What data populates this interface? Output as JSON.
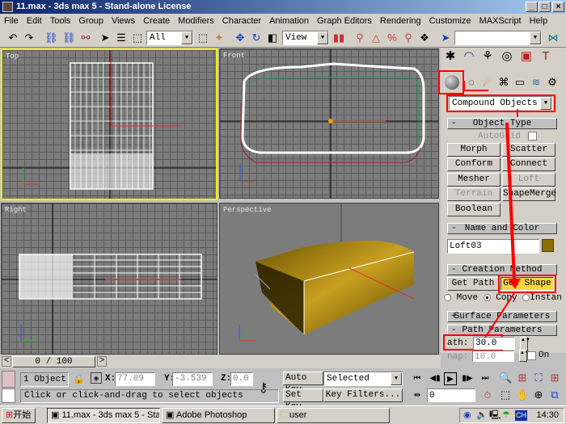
{
  "window": {
    "title": "11.max - 3ds max 5 - Stand-alone License",
    "minimize": "_",
    "maximize": "□",
    "close": "×"
  },
  "menu": [
    "File",
    "Edit",
    "Tools",
    "Group",
    "Views",
    "Create",
    "Modifiers",
    "Character",
    "Animation",
    "Graph Editors",
    "Rendering",
    "Customize",
    "MAXScript",
    "Help"
  ],
  "toolbar": {
    "selection_filter": "All",
    "reference_coord": "View",
    "named_selection": ""
  },
  "viewports": {
    "top": "Top",
    "front": "Front",
    "right": "Right",
    "perspective": "Perspective"
  },
  "command_panel": {
    "category_dropdown": "Compound Objects",
    "object_type": {
      "header": "Object Type",
      "autogrid_label": "AutoGrid",
      "buttons": [
        {
          "label": "Morph",
          "enabled": true
        },
        {
          "label": "Scatter",
          "enabled": true
        },
        {
          "label": "Conform",
          "enabled": true
        },
        {
          "label": "Connect",
          "enabled": true
        },
        {
          "label": "Mesher",
          "enabled": true
        },
        {
          "label": "Loft",
          "enabled": false
        },
        {
          "label": "Terrain",
          "enabled": false
        },
        {
          "label": "ShapeMerge",
          "enabled": true
        },
        {
          "label": "Boolean",
          "enabled": true
        }
      ]
    },
    "name_color": {
      "header": "Name and Color",
      "name": "Loft03",
      "color": "#8c6e00"
    },
    "creation_method": {
      "header": "Creation Method",
      "get_path": "Get Path",
      "get_shape": "Get Shape",
      "radio": [
        "Move",
        "Copy",
        "Instan"
      ],
      "selected": "Copy"
    },
    "surface_params_header": "Surface Parameters",
    "path_params": {
      "header": "Path Parameters",
      "path_label": "ath:",
      "path_value": "30.0",
      "snap_label": "nap:",
      "snap_value": "10.0",
      "on_label": "On"
    }
  },
  "timeline": {
    "frame_display": "0 / 100",
    "prev": "<",
    "next": ">"
  },
  "status": {
    "selection_count": "1 Object",
    "x_label": "X:",
    "x": "77.09",
    "y_label": "Y:",
    "y": "-3.539",
    "z_label": "Z:",
    "z": "0.0",
    "prompt": "Click or click-and-drag to select objects",
    "auto_key": "Auto Key",
    "set_key": "Set Key",
    "key_mode": "Selected",
    "key_filters": "Key Filters...",
    "current_frame": "0"
  },
  "taskbar": {
    "start": "开始",
    "tasks": [
      "11.max - 3ds max 5 - Sta...",
      "Adobe Photoshop",
      "user"
    ],
    "ime": "CH",
    "clock": "14:30"
  },
  "accent": {
    "highlight_red": "#ff0000",
    "active_viewport": "#f0f000",
    "get_shape_active": "#f5d640"
  }
}
